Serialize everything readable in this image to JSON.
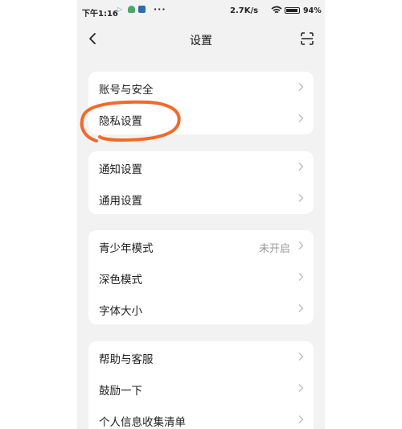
{
  "status_bar": {
    "time": "下午1:16",
    "dots": "···",
    "network_speed": "2.7K/s",
    "battery": "94"
  },
  "header": {
    "title": "设置"
  },
  "groups": [
    {
      "items": [
        {
          "label": "账号与安全"
        },
        {
          "label": "隐私设置"
        }
      ]
    },
    {
      "items": [
        {
          "label": "通知设置"
        },
        {
          "label": "通用设置"
        }
      ]
    },
    {
      "items": [
        {
          "label": "青少年模式",
          "value": "未开启"
        },
        {
          "label": "深色模式"
        },
        {
          "label": "字体大小"
        }
      ]
    },
    {
      "items": [
        {
          "label": "帮助与客服"
        },
        {
          "label": "鼓励一下"
        },
        {
          "label": "个人信息收集清单"
        }
      ]
    }
  ],
  "colors": {
    "background": "#f2f2f2",
    "card": "#ffffff",
    "annotation": "#f06a2a",
    "chevron": "#bbbbbb"
  },
  "icons": [
    "back-arrow-icon",
    "scan-icon",
    "chevron-right-icon",
    "wifi-icon",
    "battery-icon"
  ]
}
